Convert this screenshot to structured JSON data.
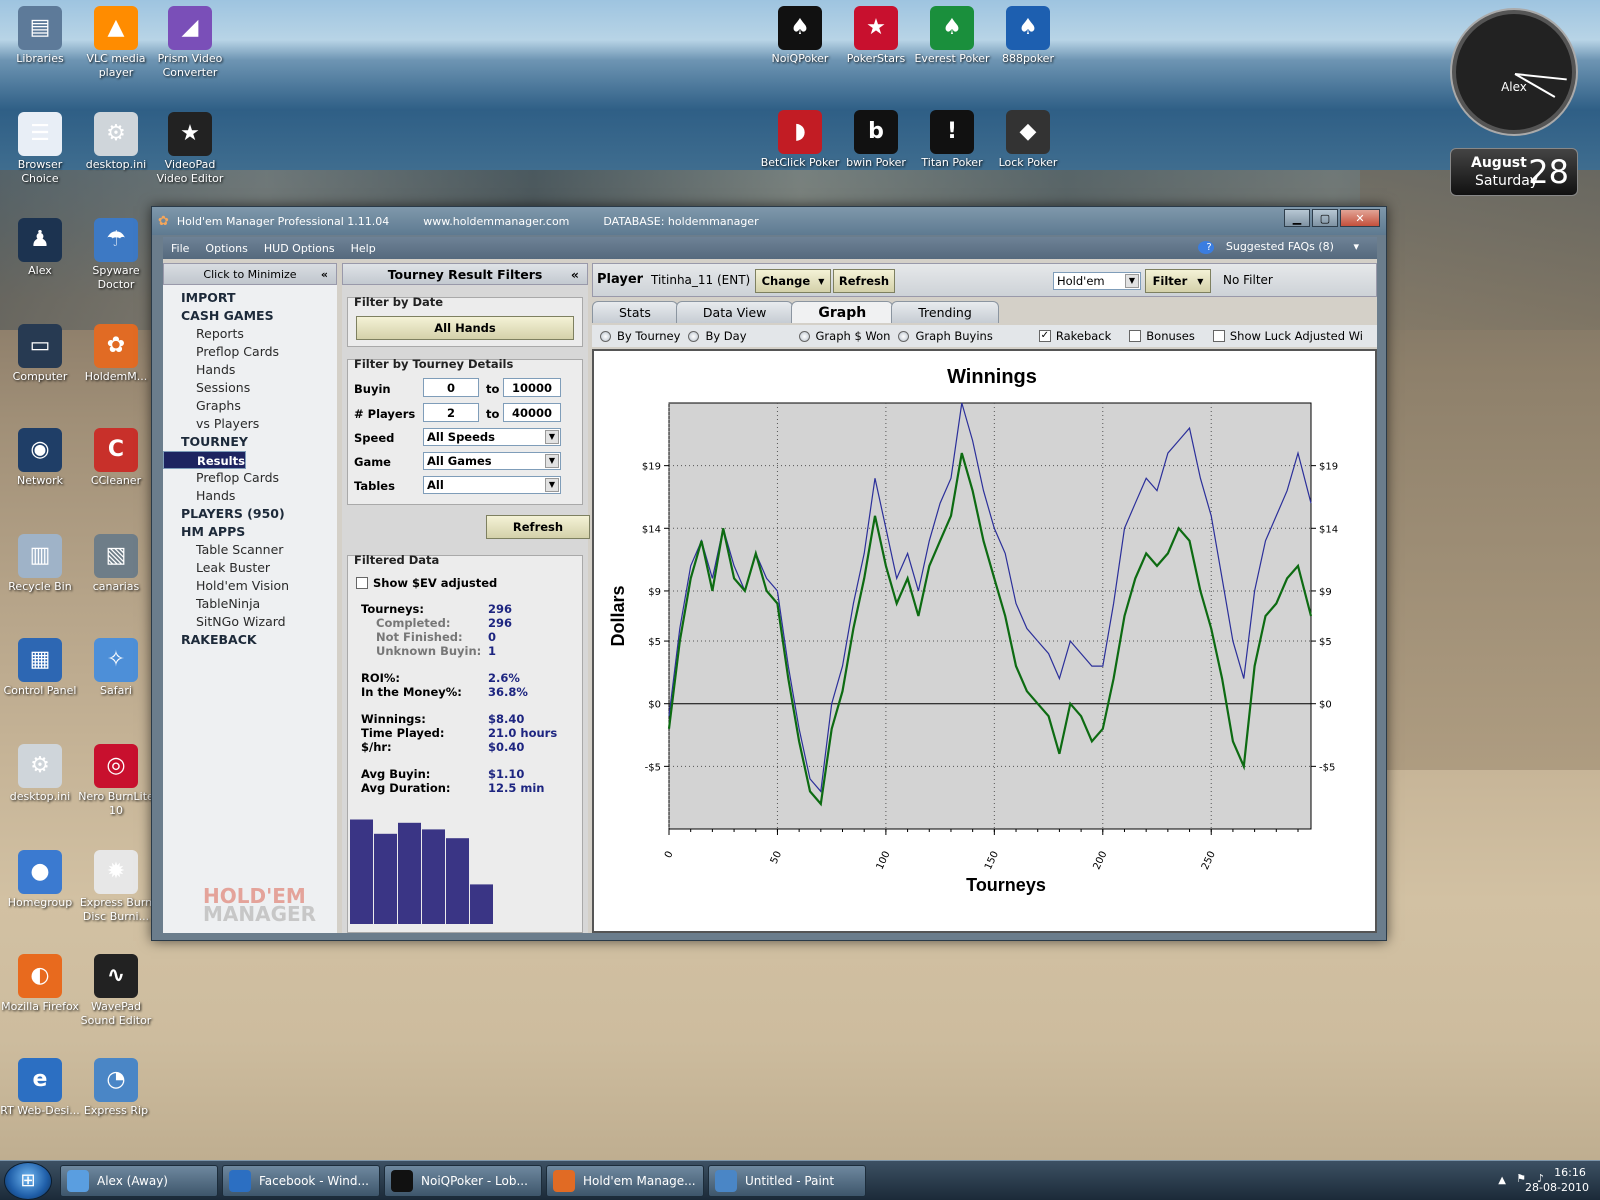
{
  "desktop": {
    "left_icons": [
      {
        "label": "Libraries",
        "color": "#5d7a99",
        "glyph": "▤",
        "x": 0,
        "y": 6
      },
      {
        "label": "VLC media player",
        "color": "#ff8c00",
        "glyph": "▲",
        "x": 76,
        "y": 6
      },
      {
        "label": "Prism Video Converter",
        "color": "#7a4fb8",
        "glyph": "◢",
        "x": 150,
        "y": 6
      },
      {
        "label": "Browser Choice",
        "color": "#e8eef6",
        "glyph": "☰",
        "x": 0,
        "y": 112
      },
      {
        "label": "desktop.ini",
        "color": "#cfd5da",
        "glyph": "⚙",
        "x": 76,
        "y": 112
      },
      {
        "label": "VideoPad Video Editor",
        "color": "#222",
        "glyph": "★",
        "x": 150,
        "y": 112
      },
      {
        "label": "Alex",
        "color": "#1c3350",
        "glyph": "♟",
        "x": 0,
        "y": 218
      },
      {
        "label": "Spyware Doctor",
        "color": "#3d79c4",
        "glyph": "☂",
        "x": 76,
        "y": 218
      },
      {
        "label": "Computer",
        "color": "#273a52",
        "glyph": "▭",
        "x": 0,
        "y": 324
      },
      {
        "label": "HoldemM...",
        "color": "#e16b24",
        "glyph": "✿",
        "x": 76,
        "y": 324
      },
      {
        "label": "Network",
        "color": "#1f3e67",
        "glyph": "◉",
        "x": 0,
        "y": 428
      },
      {
        "label": "CCleaner",
        "color": "#c8302a",
        "glyph": "C",
        "x": 76,
        "y": 428
      },
      {
        "label": "Recycle Bin",
        "color": "#9fb3c8",
        "glyph": "▥",
        "x": 0,
        "y": 534
      },
      {
        "label": "canarias",
        "color": "#6e7d88",
        "glyph": "▧",
        "x": 76,
        "y": 534
      },
      {
        "label": "Control Panel",
        "color": "#2d67b3",
        "glyph": "▦",
        "x": 0,
        "y": 638
      },
      {
        "label": "Safari",
        "color": "#4d8fd8",
        "glyph": "✧",
        "x": 76,
        "y": 638
      },
      {
        "label": "desktop.ini",
        "color": "#cfd5da",
        "glyph": "⚙",
        "x": 0,
        "y": 744
      },
      {
        "label": "Nero BurnLite 10",
        "color": "#c8102e",
        "glyph": "◎",
        "x": 76,
        "y": 744
      },
      {
        "label": "Homegroup",
        "color": "#3b7ad0",
        "glyph": "●",
        "x": 0,
        "y": 850
      },
      {
        "label": "Express Burn Disc Burni...",
        "color": "#e7e7e7",
        "glyph": "✹",
        "x": 76,
        "y": 850
      },
      {
        "label": "Mozilla Firefox",
        "color": "#e86a1e",
        "glyph": "◐",
        "x": 0,
        "y": 954
      },
      {
        "label": "WavePad Sound Editor",
        "color": "#222",
        "glyph": "∿",
        "x": 76,
        "y": 954
      },
      {
        "label": "RT Web-Desi...",
        "color": "#2c6fc2",
        "glyph": "e",
        "x": 0,
        "y": 1058
      },
      {
        "label": "Express Rip",
        "color": "#4a86c6",
        "glyph": "◔",
        "x": 76,
        "y": 1058
      }
    ],
    "top_icons": [
      {
        "label": "NoiQPoker",
        "color": "#111",
        "glyph": "♠",
        "x": 760,
        "y": 6
      },
      {
        "label": "PokerStars",
        "color": "#c8102e",
        "glyph": "★",
        "x": 836,
        "y": 6
      },
      {
        "label": "Everest Poker",
        "color": "#1a8f3c",
        "glyph": "♠",
        "x": 912,
        "y": 6
      },
      {
        "label": "888poker",
        "color": "#1d5fb0",
        "glyph": "♠",
        "x": 988,
        "y": 6
      },
      {
        "label": "BetClick Poker",
        "color": "#c21c24",
        "glyph": "◗",
        "x": 760,
        "y": 110
      },
      {
        "label": "bwin Poker",
        "color": "#111",
        "glyph": "b",
        "x": 836,
        "y": 110
      },
      {
        "label": "Titan Poker",
        "color": "#111",
        "glyph": "!",
        "x": 912,
        "y": 110
      },
      {
        "label": "Lock Poker",
        "color": "#333",
        "glyph": "◆",
        "x": 988,
        "y": 110
      }
    ],
    "clock_label": "Alex",
    "date_month": "August",
    "date_weekday": "Saturday",
    "date_day": "28"
  },
  "window": {
    "title": "Hold'em Manager Professional 1.11.04",
    "url": "www.holdemmanager.com",
    "database": "DATABASE: holdemmanager",
    "menu": [
      "File",
      "Options",
      "HUD Options",
      "Help"
    ],
    "faq": "Suggested FAQs (8)",
    "nav_header": "Click to Minimize",
    "nav": [
      {
        "label": "IMPORT",
        "kind": "cat"
      },
      {
        "label": "CASH GAMES",
        "kind": "cat"
      },
      {
        "label": "Reports",
        "kind": "sub"
      },
      {
        "label": "Preflop Cards",
        "kind": "sub"
      },
      {
        "label": "Hands",
        "kind": "sub"
      },
      {
        "label": "Sessions",
        "kind": "sub"
      },
      {
        "label": "Graphs",
        "kind": "sub"
      },
      {
        "label": "vs Players",
        "kind": "sub"
      },
      {
        "label": "TOURNEY",
        "kind": "cat"
      },
      {
        "label": "Results",
        "kind": "sub sel"
      },
      {
        "label": "Reports",
        "kind": "sub"
      },
      {
        "label": "Preflop Cards",
        "kind": "sub"
      },
      {
        "label": "Hands",
        "kind": "sub"
      },
      {
        "label": "PLAYERS (950)",
        "kind": "cat"
      },
      {
        "label": "HM APPS",
        "kind": "cat"
      },
      {
        "label": "Table Scanner",
        "kind": "sub"
      },
      {
        "label": "Leak Buster",
        "kind": "sub"
      },
      {
        "label": "Hold'em Vision",
        "kind": "sub"
      },
      {
        "label": "TableNinja",
        "kind": "sub"
      },
      {
        "label": "SitNGo Wizard",
        "kind": "sub"
      },
      {
        "label": "RAKEBACK",
        "kind": "cat"
      }
    ],
    "logo_line1": "HOLD'EM",
    "logo_line2": "MANAGER"
  },
  "filters": {
    "header": "Tourney Result Filters",
    "date_group": "Filter by Date",
    "all_hands": "All Hands",
    "details_group": "Filter by Tourney Details",
    "buyin_label": "Buyin",
    "buyin_from": "0",
    "buyin_to": "10000",
    "players_label": "# Players",
    "players_from": "2",
    "players_to": "40000",
    "to": "to",
    "speed_label": "Speed",
    "speed_value": "All Speeds",
    "game_label": "Game",
    "game_value": "All Games",
    "tables_label": "Tables",
    "tables_value": "All",
    "refresh": "Refresh",
    "filtered_group": "Filtered Data",
    "ev_label": "Show $EV adjusted",
    "stats": [
      {
        "label": "Tourneys:",
        "value": "296",
        "indent": false,
        "y": 46
      },
      {
        "label": "Completed:",
        "value": "296",
        "indent": true,
        "y": 60
      },
      {
        "label": "Not Finished:",
        "value": "0",
        "indent": true,
        "y": 74
      },
      {
        "label": "Unknown Buyin:",
        "value": "1",
        "indent": true,
        "y": 88
      },
      {
        "label": "ROI%:",
        "value": "2.6%",
        "indent": false,
        "y": 115
      },
      {
        "label": "In the Money%:",
        "value": "36.8%",
        "indent": false,
        "y": 129
      },
      {
        "label": "Winnings:",
        "value": "$8.40",
        "indent": false,
        "y": 156
      },
      {
        "label": "Time Played:",
        "value": "21.0 hours",
        "indent": false,
        "y": 170
      },
      {
        "label": "$/hr:",
        "value": "$0.40",
        "indent": false,
        "y": 184
      },
      {
        "label": "Avg Buyin:",
        "value": "$1.10",
        "indent": false,
        "y": 211
      },
      {
        "label": "Avg Duration:",
        "value": "12.5 min",
        "indent": false,
        "y": 225
      }
    ],
    "mini_bars": [
      0.95,
      0.82,
      0.92,
      0.86,
      0.78,
      0.36
    ]
  },
  "main": {
    "player_label": "Player",
    "player_name": "Titinha_11 (ENT)",
    "change": "Change",
    "refresh": "Refresh",
    "game_select": "Hold'em",
    "filter": "Filter",
    "no_filter": "No Filter",
    "tabs": [
      "Stats",
      "Data View",
      "Graph",
      "Trending"
    ],
    "active_tab": 2,
    "opt_by_tourney": "By Tourney",
    "opt_by_day": "By Day",
    "opt_graph_won": "Graph $ Won",
    "opt_graph_buyins": "Graph Buyins",
    "opt_rakeback": "Rakeback",
    "opt_bonuses": "Bonuses",
    "opt_luck": "Show Luck Adjusted Wi"
  },
  "chart_data": {
    "type": "line",
    "title": "Winnings",
    "xlabel": "Tourneys",
    "ylabel": "Dollars",
    "xlim": [
      0,
      296
    ],
    "ylim": [
      -10,
      24
    ],
    "xticks": [
      0,
      50,
      100,
      150,
      200,
      250
    ],
    "yticks": [
      -5,
      0,
      5,
      9,
      14,
      19
    ],
    "ytick_labels": [
      "-$5",
      "$0",
      "$5",
      "$9",
      "$14",
      "$19"
    ],
    "grid": true,
    "colors": {
      "blue": "#2b2f9a",
      "green": "#0d6b12"
    },
    "series": [
      {
        "color": "blue",
        "x": [
          0,
          5,
          10,
          15,
          20,
          25,
          30,
          35,
          40,
          45,
          50,
          55,
          60,
          65,
          70,
          75,
          80,
          85,
          90,
          95,
          100,
          105,
          110,
          115,
          120,
          125,
          130,
          135,
          140,
          145,
          150,
          155,
          160,
          165,
          170,
          175,
          180,
          185,
          190,
          195,
          200,
          205,
          210,
          215,
          220,
          225,
          230,
          235,
          240,
          245,
          250,
          255,
          260,
          265,
          270,
          275,
          280,
          285,
          290,
          296
        ],
        "y": [
          -1,
          6,
          11,
          13,
          10,
          14,
          11,
          9,
          12,
          10,
          9,
          3,
          -2,
          -6,
          -7,
          0,
          3,
          8,
          12,
          18,
          14,
          10,
          12,
          9,
          13,
          16,
          18,
          24,
          21,
          17,
          14,
          12,
          8,
          6,
          5,
          4,
          2,
          5,
          4,
          3,
          3,
          8,
          14,
          16,
          18,
          17,
          20,
          21,
          22,
          18,
          15,
          10,
          5,
          2,
          9,
          13,
          15,
          17,
          20,
          16
        ]
      },
      {
        "color": "green",
        "x": [
          0,
          5,
          10,
          15,
          20,
          25,
          30,
          35,
          40,
          45,
          50,
          55,
          60,
          65,
          70,
          75,
          80,
          85,
          90,
          95,
          100,
          105,
          110,
          115,
          120,
          125,
          130,
          135,
          140,
          145,
          150,
          155,
          160,
          165,
          170,
          175,
          180,
          185,
          190,
          195,
          200,
          205,
          210,
          215,
          220,
          225,
          230,
          235,
          240,
          245,
          250,
          255,
          260,
          265,
          270,
          275,
          280,
          285,
          290,
          296
        ],
        "y": [
          -2,
          5,
          10,
          13,
          9,
          14,
          10,
          9,
          12,
          9,
          8,
          2,
          -3,
          -7,
          -8,
          -2,
          1,
          6,
          10,
          15,
          11,
          8,
          10,
          7,
          11,
          13,
          15,
          20,
          17,
          13,
          10,
          7,
          3,
          1,
          0,
          -1,
          -4,
          0,
          -1,
          -3,
          -2,
          2,
          7,
          10,
          12,
          11,
          12,
          14,
          13,
          9,
          6,
          2,
          -3,
          -5,
          3,
          7,
          8,
          10,
          11,
          7
        ]
      }
    ]
  },
  "taskbar": {
    "items": [
      {
        "label": "Alex (Away)",
        "color": "#5a9ee0"
      },
      {
        "label": "Facebook - Wind...",
        "color": "#2c6fc2"
      },
      {
        "label": "NoiQPoker - Lob...",
        "color": "#111"
      },
      {
        "label": "Hold'em Manage...",
        "color": "#e16b24"
      },
      {
        "label": "Untitled - Paint",
        "color": "#4a86c6"
      }
    ],
    "time": "16:16",
    "date": "28-08-2010"
  }
}
